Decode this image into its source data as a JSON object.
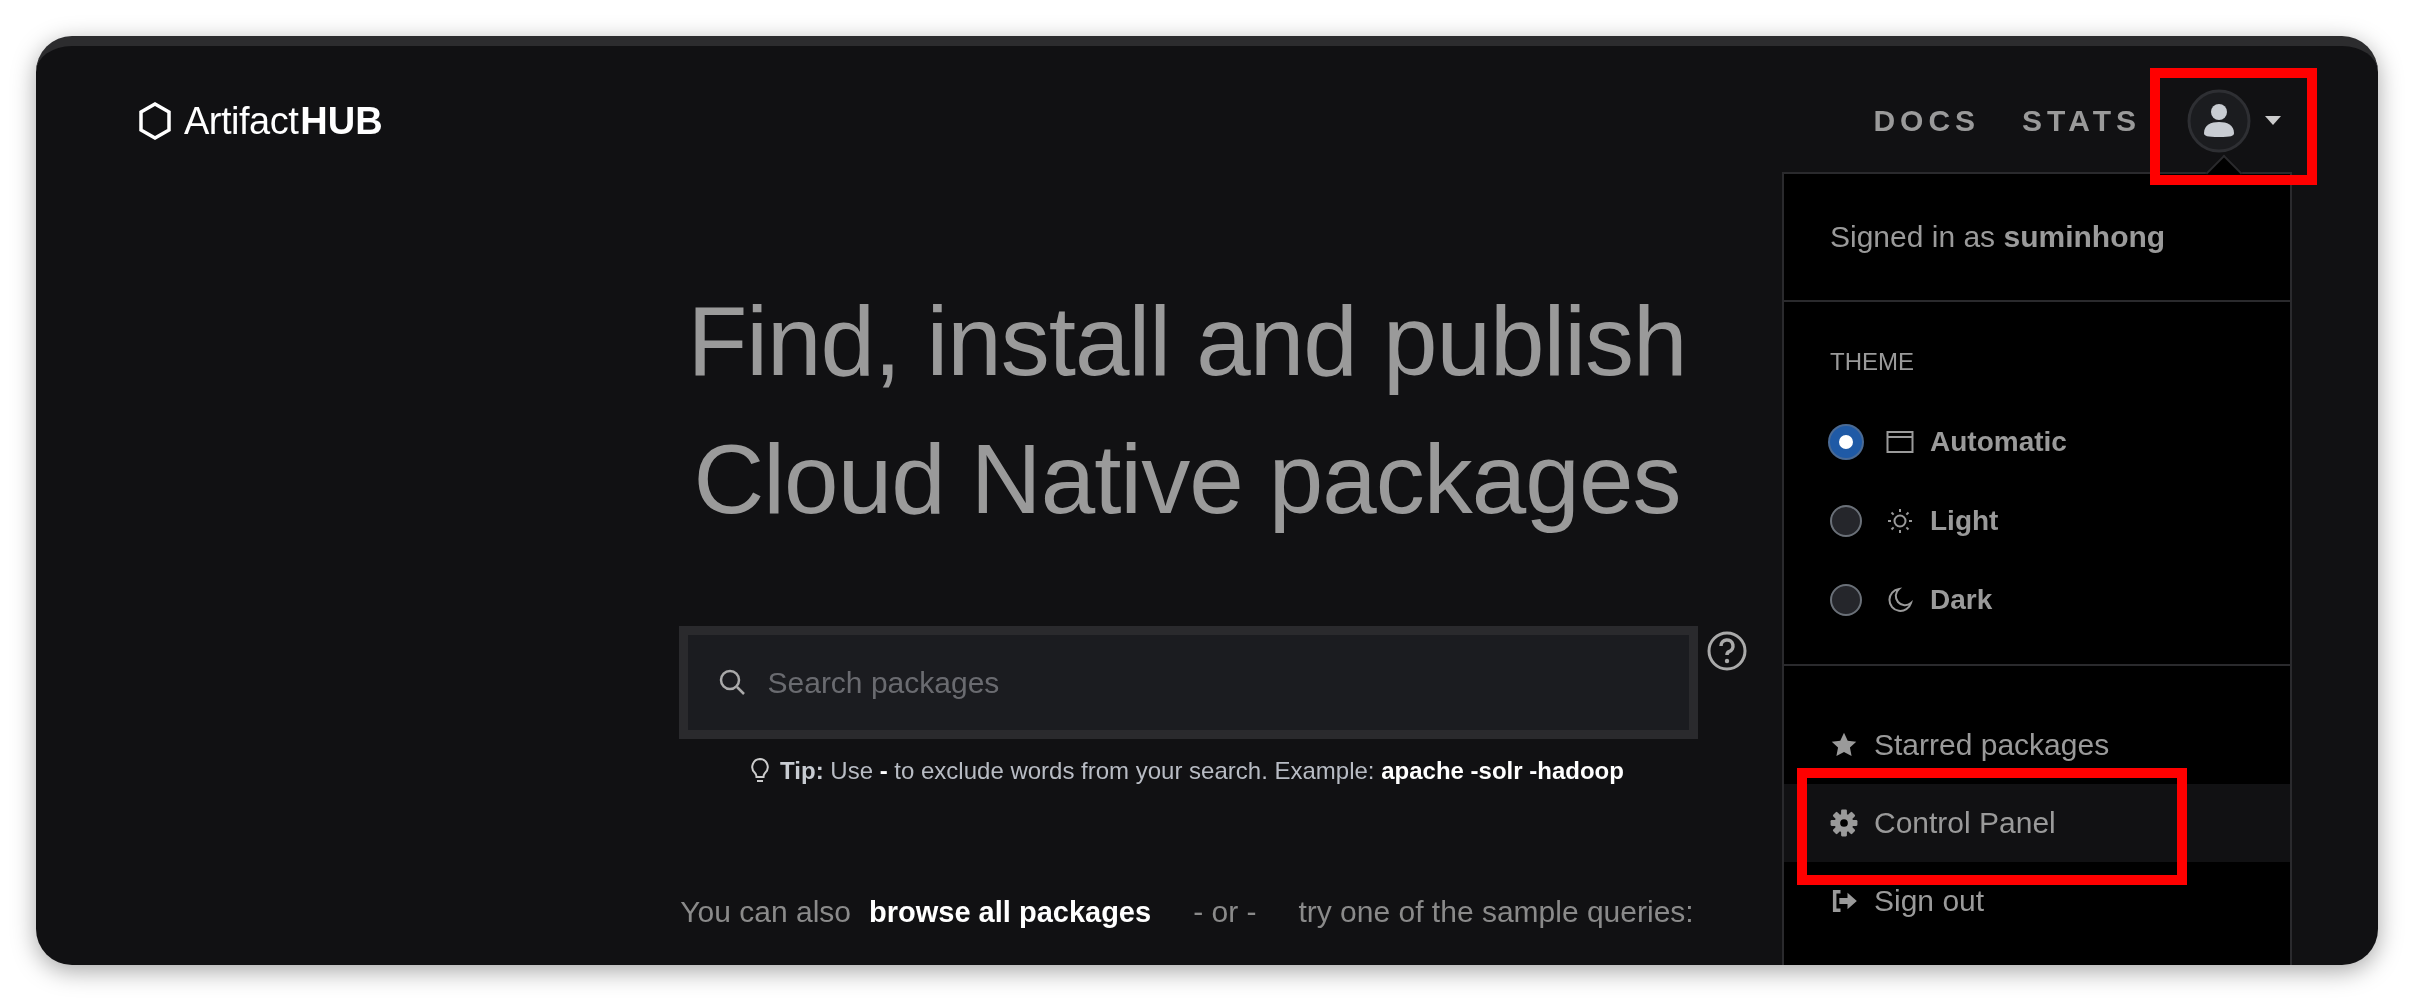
{
  "logo": {
    "text": "Artifact",
    "bold": "HUB"
  },
  "nav": [
    {
      "label": "DOCS"
    },
    {
      "label": "STATS"
    }
  ],
  "user_menu": {
    "highlighted": true,
    "signed_in_prefix": "Signed in as",
    "username": "suminhong",
    "theme_heading": "THEME",
    "themes": [
      {
        "label": "Automatic",
        "kind": "automatic",
        "selected": true
      },
      {
        "label": "Light",
        "kind": "light",
        "selected": false
      },
      {
        "label": "Dark",
        "kind": "dark",
        "selected": false
      }
    ],
    "items": [
      {
        "label": "Starred packages",
        "kind": "star",
        "selected": false,
        "highlighted": false
      },
      {
        "label": "Control Panel",
        "kind": "settings",
        "selected": true,
        "highlighted": true
      },
      {
        "label": "Sign out",
        "kind": "signout",
        "selected": false,
        "highlighted": false
      }
    ]
  },
  "hero": {
    "lines": [
      "Find, install and publish",
      "Cloud Native packages"
    ]
  },
  "search": {
    "placeholder": "Search packages"
  },
  "tip": "**Tip:** Use **-** to exclude words from your search. Example: **apache -solr -hadoop**",
  "browse": {
    "prefix": "You can also",
    "link": "browse all packages",
    "separator": "- or -",
    "suffix": "try one of the sample queries:"
  }
}
